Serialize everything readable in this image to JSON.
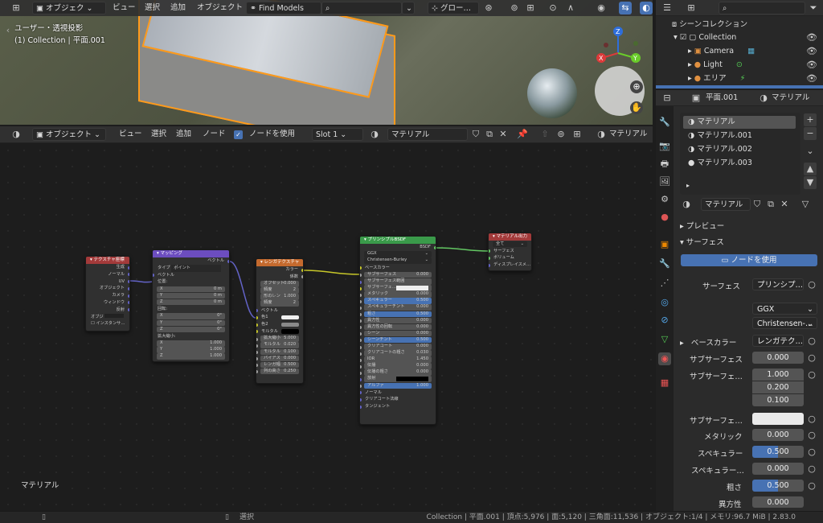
{
  "viewport": {
    "mode": "オブジェク",
    "menus": [
      "ビュー",
      "選択",
      "追加",
      "オブジェクト"
    ],
    "find_models": "Find Models",
    "orientation": "グロー…",
    "overlay_line1": "ユーザー・透視投影",
    "overlay_line2": "(1) Collection | 平面.001",
    "gizmo": {
      "z": "Z",
      "x": "X",
      "y": "Y"
    }
  },
  "node_editor": {
    "mode": "オブジェクト",
    "menus": [
      "ビュー",
      "選択",
      "追加",
      "ノード"
    ],
    "use_nodes_label": "ノードを使用",
    "slot": "Slot 1",
    "material_name": "マテリアル",
    "material_right": "マテリアル",
    "footer_label": "マテリアル",
    "nodes": {
      "texcoord": {
        "title": "テクスチャ座標",
        "outputs": [
          "生成",
          "ノーマル",
          "UV",
          "オブジェクト",
          "カメラ",
          "ウィンドウ",
          "反射"
        ],
        "object_label": "オブジ",
        "instancer_label": "インスタンサ…"
      },
      "mapping": {
        "title": "マッピング",
        "output": "ベクトル",
        "type_label": "タイプ",
        "type_value": "ポイント",
        "vector_label": "ベクトル",
        "loc_label": "位置:",
        "loc": [
          [
            "X",
            "0 m"
          ],
          [
            "Y",
            "0 m"
          ],
          [
            "Z",
            "0 m"
          ]
        ],
        "rot_label": "回転:",
        "rot": [
          [
            "X",
            "0°"
          ],
          [
            "Y",
            "0°"
          ],
          [
            "Z",
            "0°"
          ]
        ],
        "scale_label": "拡大縮小:",
        "scale": [
          [
            "X",
            "1.000"
          ],
          [
            "Y",
            "1.000"
          ],
          [
            "Z",
            "1.000"
          ]
        ]
      },
      "brick": {
        "title": "レンガテクスチャ",
        "outputs": [
          "カラー",
          "係数"
        ],
        "offset": [
          "オフセット",
          "0.000"
        ],
        "freq1": [
          "頻度",
          "2"
        ],
        "squash": [
          "形のレン",
          "1.000"
        ],
        "freq2": [
          "頻度",
          "2"
        ],
        "vector_label": "ベクトル",
        "color1": "色1",
        "color2": "色2",
        "mortar": "モルタル",
        "fields": [
          [
            "拡大縮小",
            "5.000"
          ],
          [
            "モルタル",
            "0.020"
          ],
          [
            "モルタル",
            "0.100"
          ],
          [
            "バイアス",
            "0.000"
          ],
          [
            "レンガ幅",
            "0.500"
          ],
          [
            "列の高さ",
            "0.250"
          ]
        ]
      },
      "bsdf": {
        "title": "プリンシプルBSDF",
        "output": "BSDF",
        "dist": "GGX",
        "sss_method": "Christensen-Burley",
        "base_color": "ベースカラー",
        "fields": [
          [
            "サブサーフェス",
            "0.000",
            false
          ],
          [
            "サブサーフェス範囲",
            "",
            false
          ],
          [
            "サブサーフェ…",
            "",
            false
          ],
          [
            "メタリック",
            "0.000",
            false
          ],
          [
            "スペキュラー",
            "0.500",
            true
          ],
          [
            "スペキュラーチント",
            "0.000",
            false
          ],
          [
            "粗さ",
            "0.500",
            true
          ],
          [
            "異方性",
            "0.000",
            false
          ],
          [
            "異方性の回転",
            "0.000",
            false
          ],
          [
            "シーン",
            "0.000",
            false
          ],
          [
            "シーンチント",
            "0.500",
            true
          ],
          [
            "クリアコート",
            "0.000",
            false
          ],
          [
            "クリアコートの粗さ",
            "0.030",
            false
          ],
          [
            "IOR",
            "1.450",
            false
          ],
          [
            "伝播",
            "0.000",
            false
          ],
          [
            "伝播の粗さ",
            "0.000",
            false
          ],
          [
            "放射",
            "",
            false
          ],
          [
            "アルファ",
            "1.000",
            true
          ]
        ],
        "inputs_tail": [
          "ノーマル",
          "クリアコート法線",
          "タンジェント"
        ]
      },
      "output": {
        "title": "マテリアル出力",
        "target": "全て",
        "inputs": [
          "サーフェス",
          "ボリューム",
          "ディスプレイスメ…"
        ]
      }
    }
  },
  "outliner": {
    "header": "シーンコレクション",
    "items": [
      "Collection",
      "Camera",
      "Light",
      "エリア"
    ]
  },
  "properties": {
    "object_name": "平面.001",
    "material_tab": "マテリアル",
    "slots": [
      "マテリアル",
      "マテリアル.001",
      "マテリアル.002",
      "マテリアル.003"
    ],
    "material_name": "マテリアル",
    "preview_label": "プレビュー",
    "surface_panel": "サーフェス",
    "use_nodes_button": "ノードを使用",
    "surface_label": "サーフェス",
    "surface_value": "プリンシプ…",
    "dist": "GGX",
    "sss_method": "Christensen-…",
    "base_color_label": "ベースカラー",
    "base_color_value": "レンガテク…",
    "rows": [
      {
        "label": "サブサーフェス",
        "value": "0.000"
      },
      {
        "label": "サブサーフェ…",
        "values": [
          "1.000",
          "0.200",
          "0.100"
        ]
      },
      {
        "label": "サブサーフェ…",
        "value": ""
      },
      {
        "label": "メタリック",
        "value": "0.000"
      },
      {
        "label": "スペキュラー",
        "value": "0.500"
      },
      {
        "label": "スペキュラー…",
        "value": "0.000"
      },
      {
        "label": "粗さ",
        "value": "0.500"
      },
      {
        "label": "異方性",
        "value": "0.000"
      }
    ]
  },
  "statusbar": {
    "select_label": "選択",
    "info": "Collection | 平面.001 | 頂点:5,976 | 面:5,120 | 三角面:11,536 | オブジェクト:1/4 | メモリ:96.7 MiB | 2.83.0"
  },
  "colors": {
    "selection_outline": "#ff9a1a",
    "accent_blue": "#4772b3",
    "texcoord_header": "#a33a3a",
    "mapping_header": "#6c4dbf",
    "brick_header": "#c46a2e",
    "bsdf_header": "#3a9a4a",
    "output_header": "#a33a3a"
  }
}
